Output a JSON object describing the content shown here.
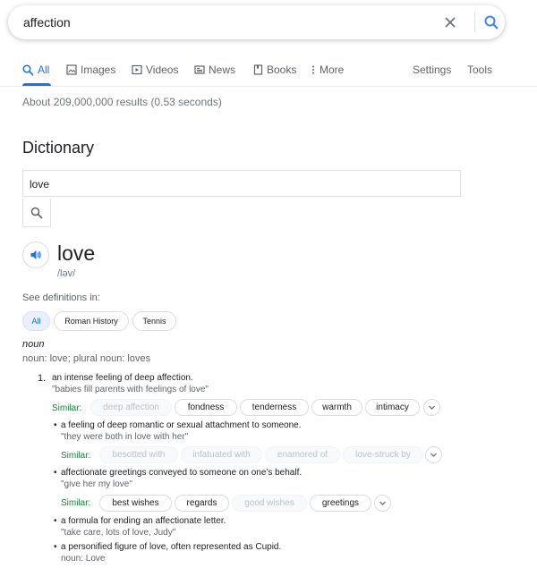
{
  "search": {
    "query": "affection"
  },
  "tabs": {
    "all": "All",
    "images": "Images",
    "videos": "Videos",
    "news": "News",
    "books": "Books",
    "more": "More",
    "settings": "Settings",
    "tools": "Tools"
  },
  "result_stats": "About 209,000,000 results (0.53 seconds)",
  "dictionary": {
    "heading": "Dictionary",
    "input_value": "love",
    "word": "love",
    "phonetic": "/ləv/",
    "see_definitions": "See definitions in:",
    "chips": [
      "All",
      "Roman History",
      "Tennis"
    ],
    "part_of_speech": "noun",
    "forms": "noun: love; plural noun: loves",
    "similar_label": "Similar:",
    "senses": [
      {
        "number": "1.",
        "definition": "an intense feeling of deep affection.",
        "example": "\"babies fill parents with feelings of love\"",
        "similar": [
          {
            "word": "deep affection",
            "faded": true
          },
          {
            "word": "fondness",
            "faded": false
          },
          {
            "word": "tenderness",
            "faded": false
          },
          {
            "word": "warmth",
            "faded": false
          },
          {
            "word": "intimacy",
            "faded": false
          }
        ]
      },
      {
        "bullet": "•",
        "definition": "a feeling of deep romantic or sexual attachment to someone.",
        "example": "\"they were both in love with her\"",
        "similar": [
          {
            "word": "besotted with",
            "faded": true
          },
          {
            "word": "infatuated with",
            "faded": true
          },
          {
            "word": "enamored of",
            "faded": true
          },
          {
            "word": "love-struck by",
            "faded": true
          }
        ]
      },
      {
        "bullet": "•",
        "definition": "affectionate greetings conveyed to someone on one's behalf.",
        "example": "\"give her my love\"",
        "similar": [
          {
            "word": "best wishes",
            "faded": false
          },
          {
            "word": "regards",
            "faded": false
          },
          {
            "word": "good wishes",
            "faded": true
          },
          {
            "word": "greetings",
            "faded": false
          }
        ]
      },
      {
        "bullet": "•",
        "definition": "a formula for ending an affectionate letter.",
        "example": "\"take care, lots of love, Judy\""
      },
      {
        "bullet": "•",
        "definition": "a personified figure of love, often represented as Cupid.",
        "extra": "noun: Love"
      }
    ]
  },
  "colors": {
    "accent": "#1a73e8",
    "similar_label": "#188038",
    "muted": "#70757a"
  },
  "icons": [
    "clear-icon",
    "search-icon",
    "images-icon",
    "videos-icon",
    "news-icon",
    "books-icon",
    "more-dots-icon",
    "speaker-icon",
    "chevron-down-icon"
  ]
}
